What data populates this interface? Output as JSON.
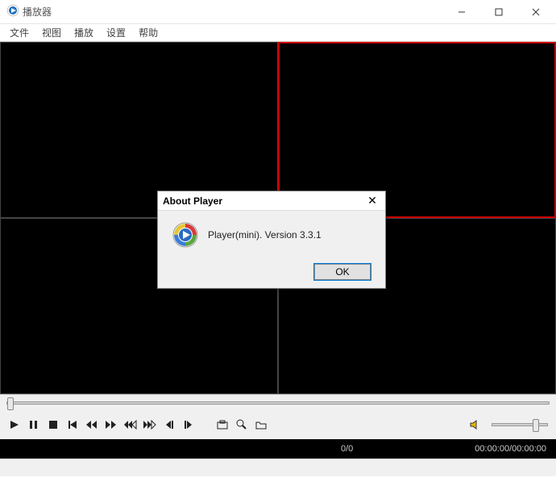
{
  "window": {
    "title": "播放器"
  },
  "menu": {
    "file": "文件",
    "view": "视图",
    "play": "播放",
    "settings": "设置",
    "help": "帮助"
  },
  "dialog": {
    "title": "About Player",
    "message": "Player(mini). Version 3.3.1",
    "ok": "OK"
  },
  "status": {
    "counter": "0/0",
    "time_elapsed": "00:00:00",
    "time_total": "00:00:00"
  }
}
